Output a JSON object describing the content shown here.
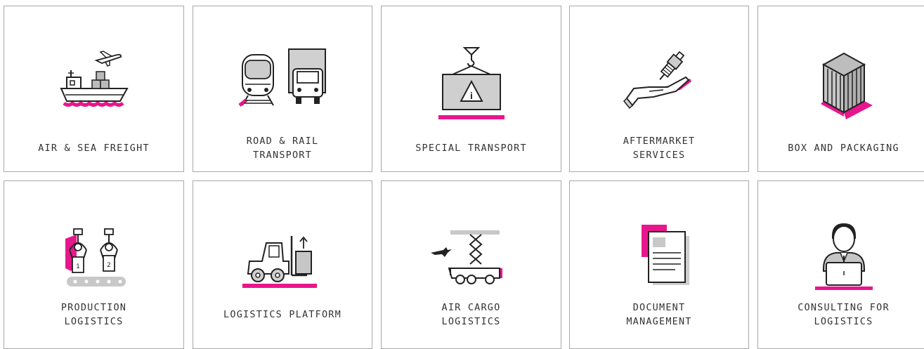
{
  "accent_color": "#e8168c",
  "tiles": [
    {
      "name": "air-sea-freight",
      "icon": "ship-plane-icon",
      "lines": [
        "AIR & SEA FREIGHT"
      ]
    },
    {
      "name": "road-rail-transport",
      "icon": "train-truck-icon",
      "lines": [
        "ROAD & RAIL",
        "TRANSPORT"
      ]
    },
    {
      "name": "special-transport",
      "icon": "crane-hazard-crate-icon",
      "lines": [
        "SPECIAL TRANSPORT"
      ]
    },
    {
      "name": "aftermarket-services",
      "icon": "hand-spark-plug-icon",
      "lines": [
        "AFTERMARKET",
        "SERVICES"
      ]
    },
    {
      "name": "box-and-packaging",
      "icon": "container-box-icon",
      "lines": [
        "BOX AND PACKAGING"
      ]
    },
    {
      "name": "production-logistics",
      "icon": "robot-conveyor-icon",
      "lines": [
        "PRODUCTION",
        "LOGISTICS"
      ]
    },
    {
      "name": "logistics-platform",
      "icon": "forklift-icon",
      "lines": [
        "LOGISTICS PLATFORM"
      ]
    },
    {
      "name": "air-cargo-logistics",
      "icon": "scissor-lift-plane-icon",
      "lines": [
        "AIR CARGO",
        "LOGISTICS"
      ]
    },
    {
      "name": "document-management",
      "icon": "document-icon",
      "lines": [
        "DOCUMENT",
        "MANAGEMENT"
      ]
    },
    {
      "name": "consulting-for-logistics",
      "icon": "consultant-laptop-icon",
      "lines": [
        "CONSULTING FOR",
        "LOGISTICS"
      ]
    }
  ]
}
